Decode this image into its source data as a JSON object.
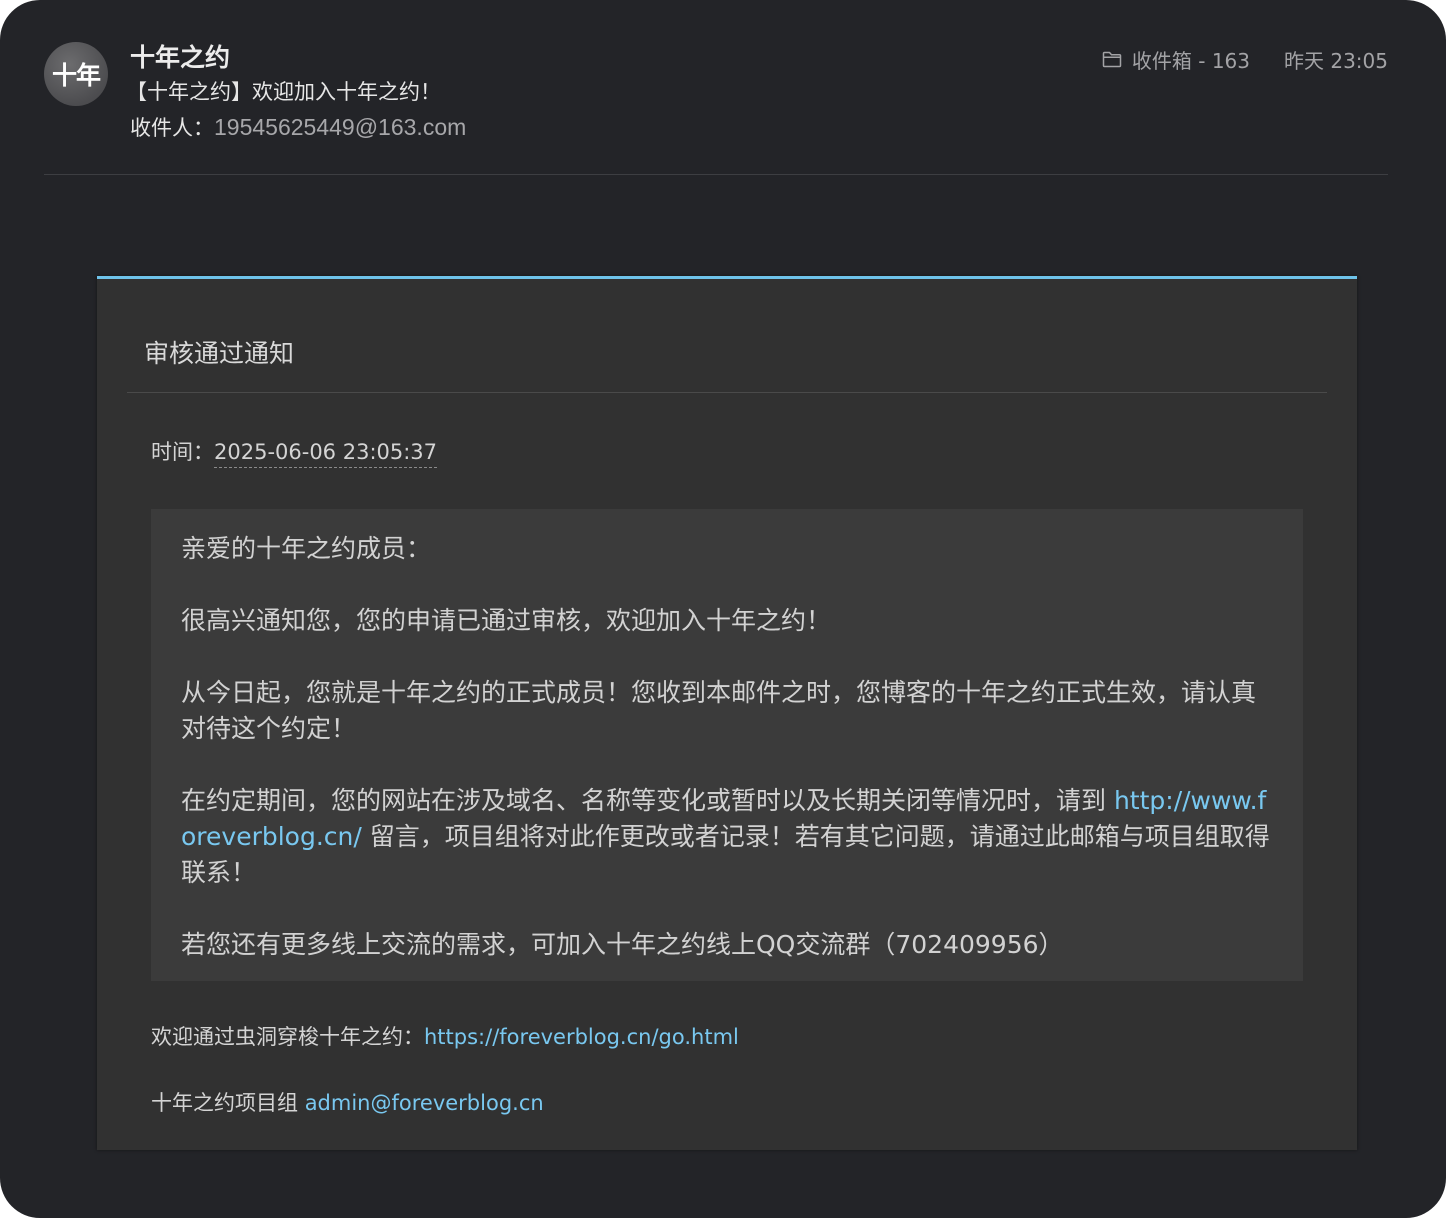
{
  "header": {
    "avatar_text": "十年",
    "sender_name": "十年之约",
    "subject": "【十年之约】欢迎加入十年之约！",
    "recipient_label": "收件人：",
    "recipient_value": "19545625449@163.com",
    "folder_label": "收件箱 - 163",
    "time": "昨天 23:05"
  },
  "card": {
    "title": "审核通过通知",
    "time_label": "时间：",
    "time_value": "2025-06-06 23:05:37",
    "message": {
      "greeting": "亲爱的十年之约成员：",
      "para1": "很高兴通知您，您的申请已通过审核，欢迎加入十年之约！",
      "para2": "从今日起，您就是十年之约的正式成员！您收到本邮件之时，您博客的十年之约正式生效，请认真对待这个约定！",
      "para3_prefix": "在约定期间，您的网站在涉及域名、名称等变化或暂时以及长期关闭等情况时，请到 ",
      "para3_link": "http://www.foreverblog.cn/",
      "para3_suffix": " 留言，项目组将对此作更改或者记录！若有其它问题，请通过此邮箱与项目组取得联系！",
      "para4": "若您还有更多线上交流的需求，可加入十年之约线上QQ交流群（702409956）"
    },
    "footer": {
      "wormhole_label": "欢迎通过虫洞穿梭十年之约：",
      "wormhole_link": "https://foreverblog.cn/go.html",
      "team_label": "十年之约项目组 ",
      "team_email": "admin@foreverblog.cn"
    }
  },
  "colors": {
    "background": "#232428",
    "card": "#313131",
    "accent": "#6ec3ea",
    "link": "#79c8f0"
  },
  "icons": {
    "folder": "folder-icon"
  }
}
